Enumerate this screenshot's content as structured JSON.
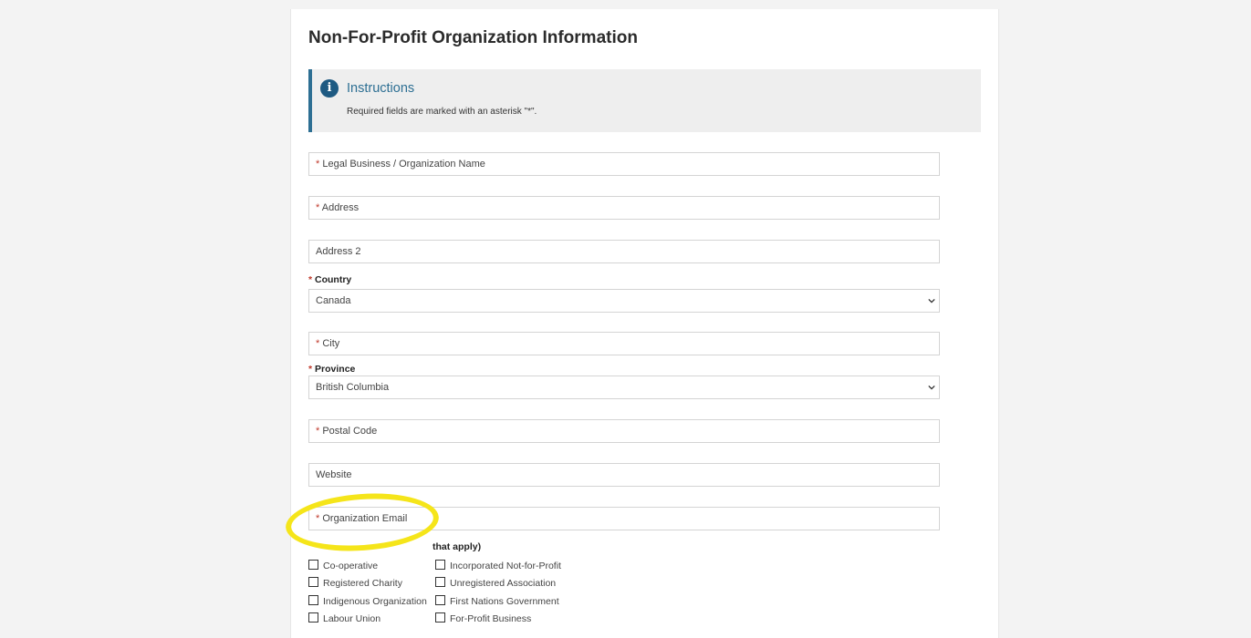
{
  "form": {
    "title": "Non-For-Profit Organization Information",
    "instructions": {
      "icon": "info-icon",
      "title": "Instructions",
      "text": "Required fields are marked with an asterisk \"*\"."
    },
    "fields": {
      "legal_name": {
        "required": "*",
        "placeholder": "Legal Business / Organization Name"
      },
      "address": {
        "required": "*",
        "placeholder": "Address"
      },
      "address2": {
        "placeholder": "Address 2"
      },
      "country": {
        "required": "*",
        "label": "Country",
        "value": "Canada"
      },
      "city": {
        "required": "*",
        "placeholder": "City"
      },
      "province": {
        "required": "*",
        "label": "Province",
        "value": "British Columbia"
      },
      "postal_code": {
        "required": "*",
        "placeholder": "Postal Code"
      },
      "website": {
        "placeholder": "Website"
      },
      "org_email": {
        "required": "*",
        "placeholder": "Organization Email"
      }
    },
    "org_type": {
      "label_partial": "that apply)",
      "options": [
        "Co-operative",
        "Incorporated Not-for-Profit",
        "Registered Charity",
        "Unregistered Association",
        "Indigenous Organization",
        "First Nations Government",
        "Labour Union",
        "For-Profit Business"
      ]
    }
  },
  "annotation": {
    "highlight_color": "#f5e51a"
  }
}
